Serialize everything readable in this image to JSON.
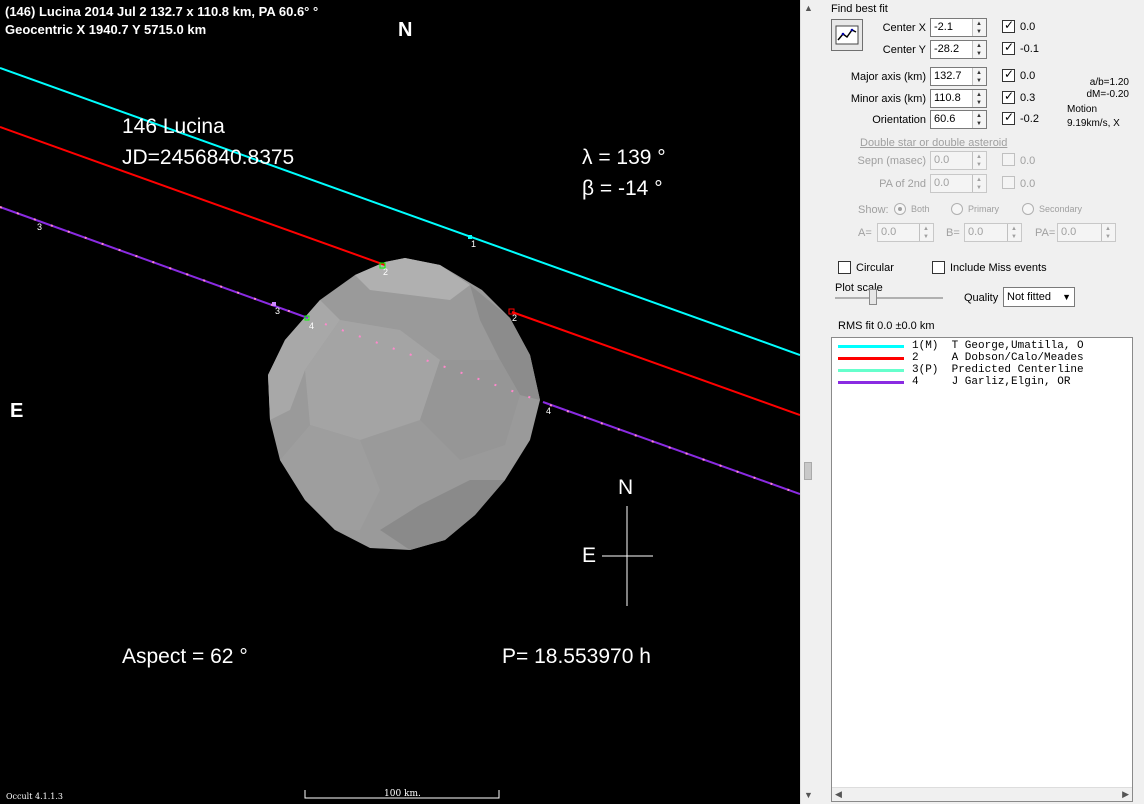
{
  "plot": {
    "header_line1": "(146) Lucina  2014 Jul 2  132.7 x 110.8 km, PA 60.6° °",
    "header_line2": "Geocentric  X  1940.7  Y 5715.0 km",
    "north_top": "N",
    "east_left": "E",
    "object_name": "146 Lucina",
    "jd": "JD=2456840.8375",
    "lambda": "λ =  139 °",
    "beta": "β =  -14 °",
    "aspect": "Aspect = 62 °",
    "period": "P= 18.553970 h",
    "compass_n": "N",
    "compass_e": "E",
    "version": "Occult 4.1.1.3",
    "scale_label": "100 km.",
    "chord_labels": [
      "1",
      "2",
      "2",
      "3",
      "3",
      "4",
      "4"
    ],
    "colors": {
      "chord1": "#00ffff",
      "chord2": "#ff0000",
      "chord4": "#8a2be2",
      "background": "#000000",
      "asteroid": "#9a9a9a"
    }
  },
  "panel": {
    "find_best_fit": "Find best fit",
    "fit_button_icon": "fit-chart-icon",
    "center_x_label": "Center X",
    "center_x_value": "-2.1",
    "center_x_unc": "0.0",
    "center_y_label": "Center Y",
    "center_y_value": "-28.2",
    "center_y_unc": "-0.1",
    "major_label": "Major axis (km)",
    "major_value": "132.7",
    "major_unc": "0.0",
    "minor_label": "Minor axis (km)",
    "minor_value": "110.8",
    "minor_unc": "0.3",
    "orient_label": "Orientation",
    "orient_value": "60.6",
    "orient_unc": "-0.2",
    "ab_ratio": "a/b=1.20",
    "dm": "dM=-0.20",
    "motion_label": "Motion",
    "motion_value": "9.19km/s, X",
    "double_link": "Double star  or  double asteroid",
    "sepn_label": "Sepn (masec)",
    "sepn_value": "0.0",
    "sepn_unc": "0.0",
    "pa2_label": "PA of 2nd",
    "pa2_value": "0.0",
    "pa2_unc": "0.0",
    "show_label": "Show:",
    "show_both": "Both",
    "show_primary": "Primary",
    "show_secondary": "Secondary",
    "a_label": "A=",
    "a_value": "0.0",
    "b_label": "B=",
    "b_value": "0.0",
    "pa_label": "PA=",
    "pa_value": "0.0",
    "circular": "Circular",
    "include_miss": "Include Miss events",
    "plot_scale": "Plot scale",
    "quality_label": "Quality",
    "quality_value": "Not fitted",
    "rms": "RMS fit  0.0 ±0.0 km"
  },
  "legend": [
    {
      "text": "1(M)  T George,Umatilla, O",
      "color": "#00ffff"
    },
    {
      "text": "2     A Dobson/Calo/Meades",
      "color": "#ff0000"
    },
    {
      "text": "3(P)  Predicted Centerline",
      "color": "#66ffcc"
    },
    {
      "text": "4     J Garliz,Elgin, OR",
      "color": "#8a2be2"
    }
  ]
}
